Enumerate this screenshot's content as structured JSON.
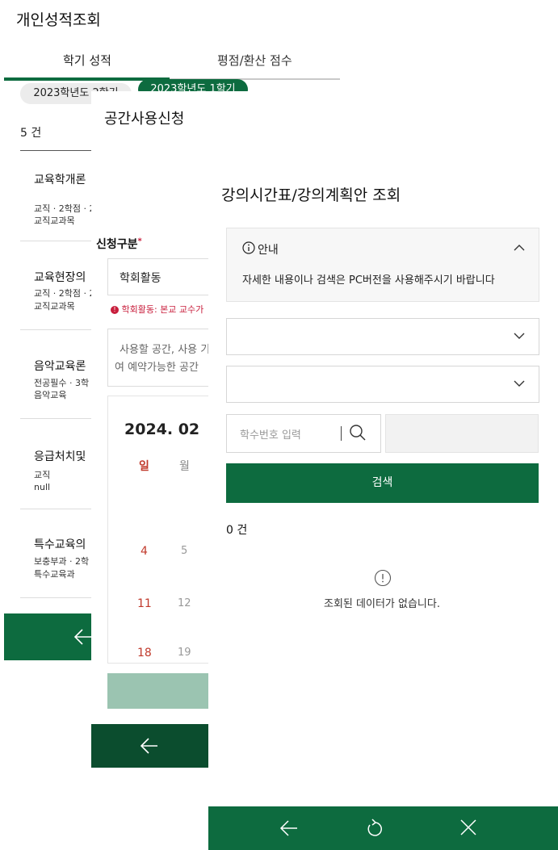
{
  "layer1": {
    "title": "개인성적조회",
    "tabs": [
      {
        "label": "학기 성적"
      },
      {
        "label": "평점/환산 점수"
      }
    ],
    "semester_chips": [
      "2023학년도 2학기",
      "2023학년도 1학기"
    ],
    "count": "5 건",
    "courses": [
      {
        "name": "교육학개론",
        "meta1": "교직 · 2학점 · 2",
        "meta2": "교직교과목"
      },
      {
        "name": "교육현장의",
        "meta1": "교직 · 2학점 · 2",
        "meta2": "교직교과목"
      },
      {
        "name": "음악교육론",
        "meta1": "전공필수 · 3학",
        "meta2": "음악교육"
      },
      {
        "name": "응급처치및",
        "meta1": "교직",
        "meta2": "null"
      },
      {
        "name": "특수교육의",
        "meta1": "보충부과 · 2학",
        "meta2": "특수교육과"
      }
    ]
  },
  "layer2": {
    "title": "공간사용신청",
    "section_label": "신청구분",
    "required_mark": "*",
    "select_value": "학회활동",
    "notice": "학회활동: 본교 교수가",
    "textarea_placeholder_1": "사용할 공간, 사용 기",
    "textarea_placeholder_2": "여 예약가능한 공간",
    "calendar": {
      "month": "2024. 02",
      "weekday_sun": "일",
      "weekday_mon": "월",
      "rows": [
        [
          "4",
          "5"
        ],
        [
          "11",
          "12"
        ],
        [
          "18",
          "19"
        ]
      ]
    }
  },
  "layer3": {
    "title": "강의시간표/강의계획안 조회",
    "info_title": "안내",
    "info_text": "자세한 내용이나 검색은 PC버전을 사용해주시기 바랍니다",
    "student_input_placeholder": "학수번호 입력",
    "search_button": "검색",
    "count": "0 건",
    "empty_text": "조회된 데이터가 없습니다."
  },
  "colors": {
    "brand_green": "#0d6b3f",
    "dark_green": "#0b4d2e",
    "faded_green": "#9bc4b1",
    "sunday_red": "#c0392b",
    "notice_red": "#c81e3c"
  }
}
